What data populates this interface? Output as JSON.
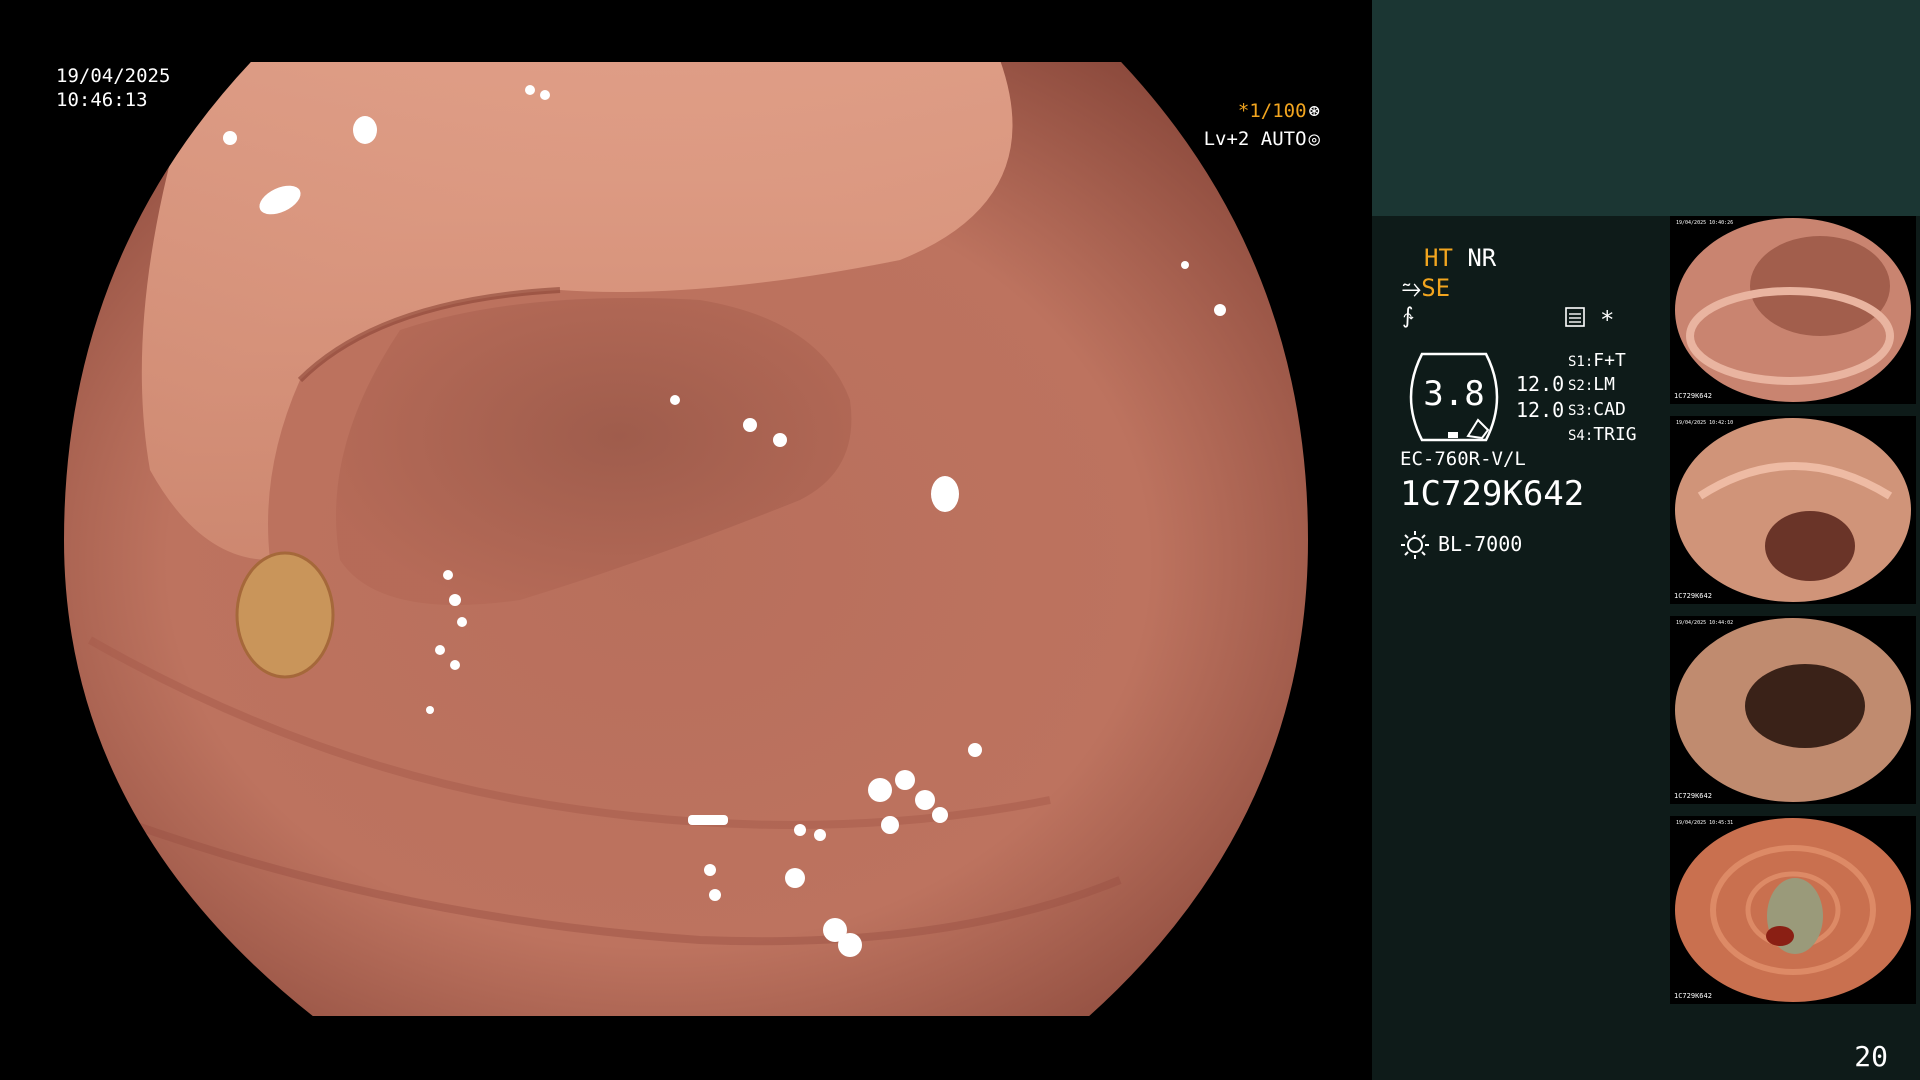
{
  "overlay": {
    "date": "19/04/2025",
    "time": "10:46:13",
    "shutter": "*1/100",
    "shutter_icon": "aperture-icon",
    "level": "Lv+2 AUTO",
    "level_icon": "iris-icon"
  },
  "info": {
    "ht": "HT",
    "nr": "NR",
    "se": "SE",
    "hex_value": "3.8",
    "val_a": "12.0",
    "val_b": "12.0",
    "switches": [
      {
        "key": "S1:",
        "value": "F+T"
      },
      {
        "key": "S2:",
        "value": "LM"
      },
      {
        "key": "S3:",
        "value": "CAD"
      },
      {
        "key": "S4:",
        "value": "TRIG"
      }
    ],
    "star": "*",
    "model": "EC-760R-V/L",
    "serial": "1C729K642",
    "light_source": "BL-7000",
    "page_number": "20"
  },
  "thumbnails": [
    {
      "label": "1C729K642",
      "date": "19/04/2025 10:40:26"
    },
    {
      "label": "1C729K642",
      "date": "19/04/2025 10:42:10"
    },
    {
      "label": "1C729K642",
      "date": "19/04/2025 10:44:02"
    },
    {
      "label": "1C729K642",
      "date": "19/04/2025 10:45:31"
    }
  ],
  "colors": {
    "panel_bg": "#0e1b19",
    "panel_top": "#1b3633",
    "accent_orange": "#f2a51f",
    "mucosa": "#c47a66"
  }
}
